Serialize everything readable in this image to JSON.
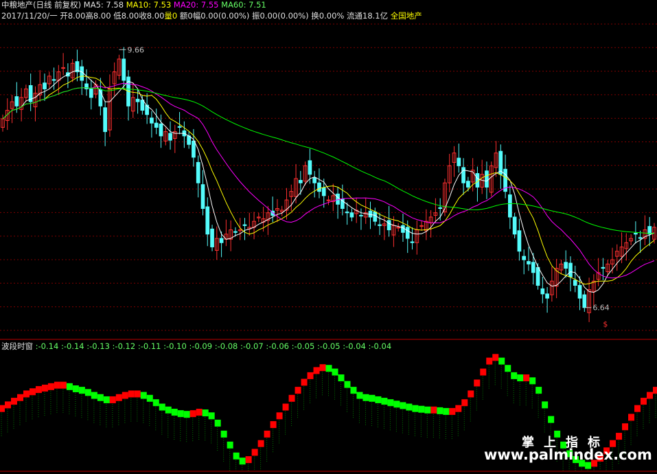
{
  "header": {
    "stock": "中粮地产(日线 前复权)",
    "ma5": "MA5: 7.58",
    "ma10": "MA10: 7.53",
    "ma20": "MA20: 7.55",
    "ma60": "MA60: 7.51",
    "date": "2017/11/20/一",
    "open": "开8.00",
    "high": "高8.00",
    "low": "低8.00",
    "close": "收8.00",
    "vol": "量0",
    "amount": "额0",
    "range": "幅0.00(0.00%)",
    "amplitude": "振0.00(0.00%)",
    "turnover": "换0.00%",
    "float": "流通18.1亿",
    "sector": "全国地产"
  },
  "sub_header": {
    "name": "波段时窗",
    "values": [
      ":-0.14",
      ":-0.14",
      ":-0.13",
      ":-0.12",
      ":-0.11",
      ":-0.10",
      ":-0.09",
      ":-0.08",
      ":-0.07",
      ":-0.06",
      ":-0.05",
      ":-0.05",
      ":-0.04",
      ":-0.04"
    ]
  },
  "watermark": {
    "cn": "掌上指标",
    "url": "www.palmindex.com"
  },
  "colors": {
    "up": "#ff3030",
    "down": "#54fcfc",
    "ma5": "#ffffff",
    "ma10": "#ffff00",
    "ma20": "#ff00ff",
    "ma60": "#00ff00",
    "grid": "#800000",
    "wave_up": "#ff0000",
    "wave_down": "#00ff00"
  },
  "chart_data": [
    {
      "type": "candlestick",
      "ylim": [
        6.3,
        10.0
      ],
      "grid": true,
      "annotations": [
        {
          "label": "9.66",
          "index": 25,
          "value": 9.66
        },
        {
          "label": "6.64",
          "index": 125,
          "value": 6.64
        },
        {
          "label": "$",
          "index": 129,
          "value": 6.45
        }
      ],
      "ma_series": [
        "MA5",
        "MA10",
        "MA20",
        "MA60"
      ],
      "close": [
        8.85,
        8.95,
        9.05,
        9.0,
        9.1,
        9.2,
        9.05,
        9.15,
        9.25,
        9.2,
        9.35,
        9.3,
        9.4,
        9.45,
        9.35,
        9.5,
        9.4,
        9.3,
        9.2,
        9.1,
        9.25,
        9.0,
        8.7,
        9.2,
        9.4,
        9.55,
        9.3,
        9.0,
        9.1,
        9.05,
        8.95,
        8.9,
        8.8,
        8.75,
        8.65,
        8.7,
        8.6,
        8.7,
        8.75,
        8.65,
        8.55,
        8.4,
        8.1,
        7.8,
        7.5,
        7.35,
        7.45,
        7.4,
        7.5,
        7.55,
        7.52,
        7.55,
        7.6,
        7.58,
        7.65,
        7.7,
        7.68,
        7.75,
        7.72,
        7.8,
        7.78,
        7.9,
        8.0,
        8.15,
        8.1,
        8.3,
        8.2,
        8.1,
        8.0,
        7.95,
        7.9,
        7.95,
        7.85,
        7.8,
        7.75,
        7.7,
        7.78,
        7.72,
        7.75,
        7.7,
        7.65,
        7.6,
        7.62,
        7.55,
        7.6,
        7.58,
        7.52,
        7.45,
        7.4,
        7.55,
        7.6,
        7.65,
        7.7,
        7.75,
        7.8,
        8.1,
        8.3,
        8.45,
        8.3,
        8.1,
        8.05,
        8.25,
        8.05,
        8.2,
        8.05,
        8.3,
        8.45,
        8.2,
        8.0,
        7.7,
        7.5,
        7.3,
        7.2,
        7.15,
        7.05,
        6.9,
        6.8,
        6.75,
        6.95,
        7.1,
        7.15,
        7.1,
        7.0,
        6.9,
        6.75,
        6.64,
        6.85,
        6.95,
        7.05,
        7.1,
        7.15,
        7.2,
        7.3,
        7.35,
        7.4,
        7.45,
        7.5,
        7.45,
        7.55,
        7.5,
        7.58
      ]
    },
    {
      "type": "line",
      "name": "波段时窗",
      "values": [
        0.3,
        0.35,
        0.4,
        0.45,
        0.5,
        0.53,
        0.56,
        0.58,
        0.6,
        0.62,
        0.62,
        0.6,
        0.57,
        0.55,
        0.52,
        0.48,
        0.45,
        0.42,
        0.42,
        0.45,
        0.48,
        0.5,
        0.5,
        0.48,
        0.44,
        0.38,
        0.32,
        0.28,
        0.25,
        0.23,
        0.22,
        0.23,
        0.25,
        0.24,
        0.2,
        0.1,
        -0.05,
        -0.2,
        -0.35,
        -0.42,
        -0.4,
        -0.3,
        -0.18,
        -0.05,
        0.08,
        0.2,
        0.32,
        0.44,
        0.55,
        0.66,
        0.75,
        0.82,
        0.86,
        0.85,
        0.8,
        0.72,
        0.63,
        0.55,
        0.48,
        0.45,
        0.44,
        0.42,
        0.4,
        0.38,
        0.36,
        0.34,
        0.32,
        0.3,
        0.29,
        0.28,
        0.28,
        0.27,
        0.26,
        0.26,
        0.3,
        0.38,
        0.5,
        0.65,
        0.8,
        0.95,
        1.0,
        0.95,
        0.85,
        0.75,
        0.72,
        0.72,
        0.68,
        0.55,
        0.35,
        0.15,
        -0.05,
        -0.2,
        -0.32,
        -0.4,
        -0.45,
        -0.48,
        -0.45,
        -0.38,
        -0.28,
        -0.18,
        -0.08,
        0.05,
        0.18,
        0.3,
        0.4,
        0.48,
        0.55
      ]
    }
  ]
}
